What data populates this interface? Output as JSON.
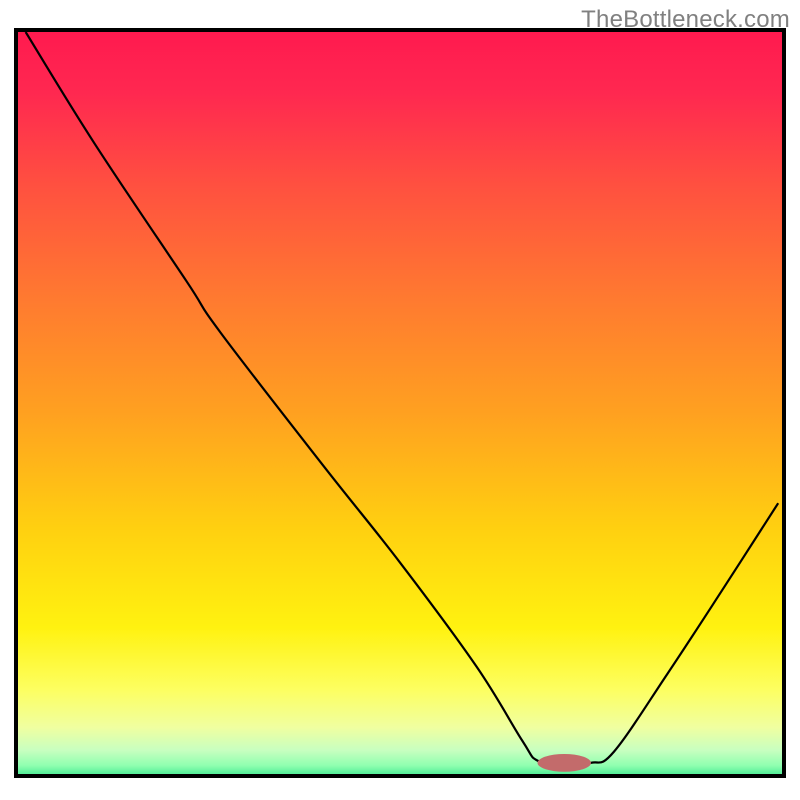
{
  "watermark": "TheBottleneck.com",
  "colors": {
    "border": "#000000",
    "gradient_stops": [
      {
        "offset": 0.0,
        "color": "#ff1a4f"
      },
      {
        "offset": 0.08,
        "color": "#ff2850"
      },
      {
        "offset": 0.2,
        "color": "#ff5040"
      },
      {
        "offset": 0.35,
        "color": "#ff7a30"
      },
      {
        "offset": 0.5,
        "color": "#ffa120"
      },
      {
        "offset": 0.65,
        "color": "#ffd010"
      },
      {
        "offset": 0.78,
        "color": "#fff210"
      },
      {
        "offset": 0.86,
        "color": "#fdff60"
      },
      {
        "offset": 0.91,
        "color": "#f0ffa0"
      },
      {
        "offset": 0.94,
        "color": "#c8ffc0"
      },
      {
        "offset": 0.96,
        "color": "#90ffb0"
      },
      {
        "offset": 0.975,
        "color": "#40e890"
      },
      {
        "offset": 0.99,
        "color": "#18d878"
      },
      {
        "offset": 1.0,
        "color": "#10d070"
      }
    ],
    "curve": "#000000",
    "marker": "#c36b6b"
  },
  "chart_data": {
    "type": "line",
    "title": "",
    "xlabel": "",
    "ylabel": "",
    "x_range": [
      0,
      100
    ],
    "y_range": [
      0,
      100
    ],
    "marker": {
      "x": 71.5,
      "y": 1.5,
      "rx": 3.5,
      "ry": 1.2
    },
    "series": [
      {
        "name": "bottleneck-curve",
        "points": [
          {
            "x": 1.0,
            "y": 100.0
          },
          {
            "x": 10.0,
            "y": 85.0
          },
          {
            "x": 22.0,
            "y": 66.5
          },
          {
            "x": 26.5,
            "y": 59.5
          },
          {
            "x": 40.0,
            "y": 41.5
          },
          {
            "x": 50.0,
            "y": 28.5
          },
          {
            "x": 60.0,
            "y": 14.5
          },
          {
            "x": 66.0,
            "y": 4.5
          },
          {
            "x": 68.0,
            "y": 1.8
          },
          {
            "x": 71.5,
            "y": 1.3
          },
          {
            "x": 75.0,
            "y": 1.5
          },
          {
            "x": 78.0,
            "y": 3.0
          },
          {
            "x": 85.0,
            "y": 13.5
          },
          {
            "x": 92.0,
            "y": 24.5
          },
          {
            "x": 99.5,
            "y": 36.5
          }
        ]
      }
    ]
  }
}
